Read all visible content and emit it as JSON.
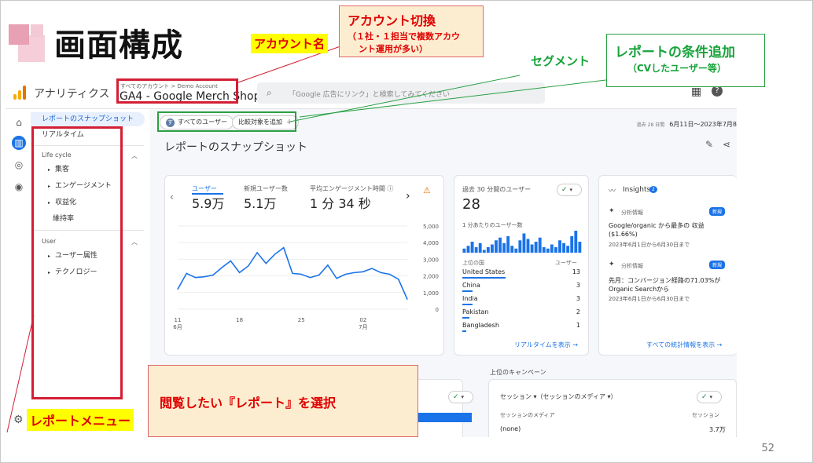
{
  "slide": {
    "title": "画面構成",
    "page_number": "52"
  },
  "annotations": {
    "account_name": "アカウント名",
    "account_switch_title": "アカウント切換",
    "account_switch_note_1": "（１社・１担当で複数アカウ",
    "account_switch_note_2": "ント運用が多い）",
    "segment": "セグメント",
    "report_condition_title": "レポートの条件追加",
    "report_condition_note": "（CVしたユーザー等）",
    "report_menu": "レポートメニュー",
    "select_report": "閲覧したい『レポート』を選択"
  },
  "header": {
    "product_name": "アナリティクス",
    "account_breadcrumb": "すべてのアカウント > Demo Account",
    "property_name": "GA4 - Google Merch Shop",
    "search_placeholder": "「Google 広告にリンク」と検索してみてください"
  },
  "nav": {
    "snapshot": "レポートのスナップショット",
    "realtime": "リアルタイム",
    "group_lifecycle": "Life cycle",
    "acquisition": "集客",
    "engagement": "エンゲージメント",
    "monetization": "収益化",
    "retention": "維持率",
    "group_user": "User",
    "user_attributes": "ユーザー属性",
    "technology": "テクノロジー"
  },
  "toolbar": {
    "segment_chip": "すべてのユーザー",
    "segment_initial": "す",
    "compare_chip": "比較対象を追加",
    "date_prefix": "過去 28 日間",
    "date_range": "6月11日～2023年7月8"
  },
  "main": {
    "title": "レポートのスナップショット"
  },
  "metrics": {
    "users_label": "ユーザー",
    "users_value": "5.9万",
    "new_users_label": "新規ユーザー数",
    "new_users_value": "5.1万",
    "engagement_label": "平均エンゲージメント時間",
    "engagement_value": "1 分 34 秒"
  },
  "chart_data": {
    "type": "line",
    "y_ticks": [
      "5,000",
      "4,000",
      "3,000",
      "2,000",
      "1,000",
      "0"
    ],
    "ylim": [
      0,
      5000
    ],
    "x_ticks": [
      {
        "day": "11",
        "month": "6月"
      },
      {
        "day": "18",
        "month": ""
      },
      {
        "day": "25",
        "month": ""
      },
      {
        "day": "02",
        "month": "7月"
      }
    ],
    "values": [
      1200,
      2150,
      1900,
      1950,
      2050,
      2500,
      2900,
      2200,
      2600,
      3400,
      2750,
      3300,
      3700,
      2150,
      2100,
      1900,
      2050,
      2650,
      1850,
      2100,
      2200,
      2250,
      2450,
      2200,
      2100,
      1800,
      600
    ],
    "color": "#1a73e8"
  },
  "realtime": {
    "label": "過去 30 分間のユーザー",
    "value": "28",
    "per_minute_label": "1 分あたりのユーザー数",
    "bars": [
      3,
      5,
      8,
      4,
      7,
      2,
      4,
      6,
      9,
      11,
      7,
      12,
      5,
      3,
      9,
      14,
      10,
      6,
      8,
      11,
      4,
      3,
      6,
      4,
      9,
      7,
      5,
      12,
      16,
      8
    ],
    "col_country": "上位の国",
    "col_users": "ユーザー",
    "rows": [
      {
        "country": "United States",
        "users": "13",
        "share": 0.92
      },
      {
        "country": "China",
        "users": "3",
        "share": 0.22
      },
      {
        "country": "India",
        "users": "3",
        "share": 0.22
      },
      {
        "country": "Pakistan",
        "users": "2",
        "share": 0.15
      },
      {
        "country": "Bangladesh",
        "users": "1",
        "share": 0.08
      }
    ],
    "link": "リアルタイムを表示 →"
  },
  "insights": {
    "title": "Insights",
    "count": "2",
    "item1_tag": "分析情報",
    "item1_badge": "新規",
    "item1_text_1": "Google/organic から最多の 収益",
    "item1_text_2": "($1.66%)",
    "item1_date": "2023年6月1日から6月30日まで",
    "item2_tag": "分析情報",
    "item2_badge": "新規",
    "item2_text_1": "先月：コンバージョン経路の71.03%が",
    "item2_text_2": "Organic Searchから",
    "item2_date": "2023年6月1日から6月30日まで",
    "link": "すべての統計情報を表示 →"
  },
  "campaign": {
    "section_label": "上位のキャンペーン",
    "dropdown": "セッション ▾（セッションのメディア ▾）",
    "col_medium": "セッションのメディア",
    "col_sessions": "セッション",
    "row1_medium": "(none)",
    "row1_sessions": "3.7万"
  },
  "colors": {
    "accent": "#1a73e8",
    "annotation_red": "#d41e34",
    "annotation_green": "#2aa043",
    "annotation_yellow": "#ffff00"
  }
}
